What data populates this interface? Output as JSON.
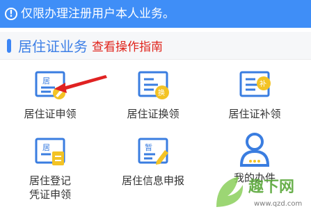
{
  "notice": {
    "icon": "exclamation-circle-icon",
    "text": "仅限办理注册用户本人业务。"
  },
  "section": {
    "title": "居住证业务",
    "guide_link": "查看操作指南"
  },
  "services": [
    {
      "label": "居住证申领",
      "icon": "card-edit-icon",
      "glyph": "居"
    },
    {
      "label": "居住证换领",
      "icon": "card-exchange-icon",
      "glyph": "换"
    },
    {
      "label": "居住证补领",
      "icon": "card-reissue-icon",
      "glyph": "补"
    },
    {
      "label_line1": "居住登记",
      "label_line2": "凭证申领",
      "icon": "card-document-icon",
      "glyph": "居"
    },
    {
      "label": "居住信息申报",
      "icon": "card-report-icon",
      "glyph": "暂"
    },
    {
      "label": "我的办件",
      "icon": "user-profile-icon"
    }
  ],
  "watermark": {
    "text_cn": "趣下网",
    "text_url": "www.qzd.com"
  },
  "colors": {
    "banner": "#3f8ef7",
    "accent": "#3d86f5",
    "link_red": "#e0231b",
    "icon_blue": "#3a7de0",
    "icon_yellow": "#f3c325"
  }
}
